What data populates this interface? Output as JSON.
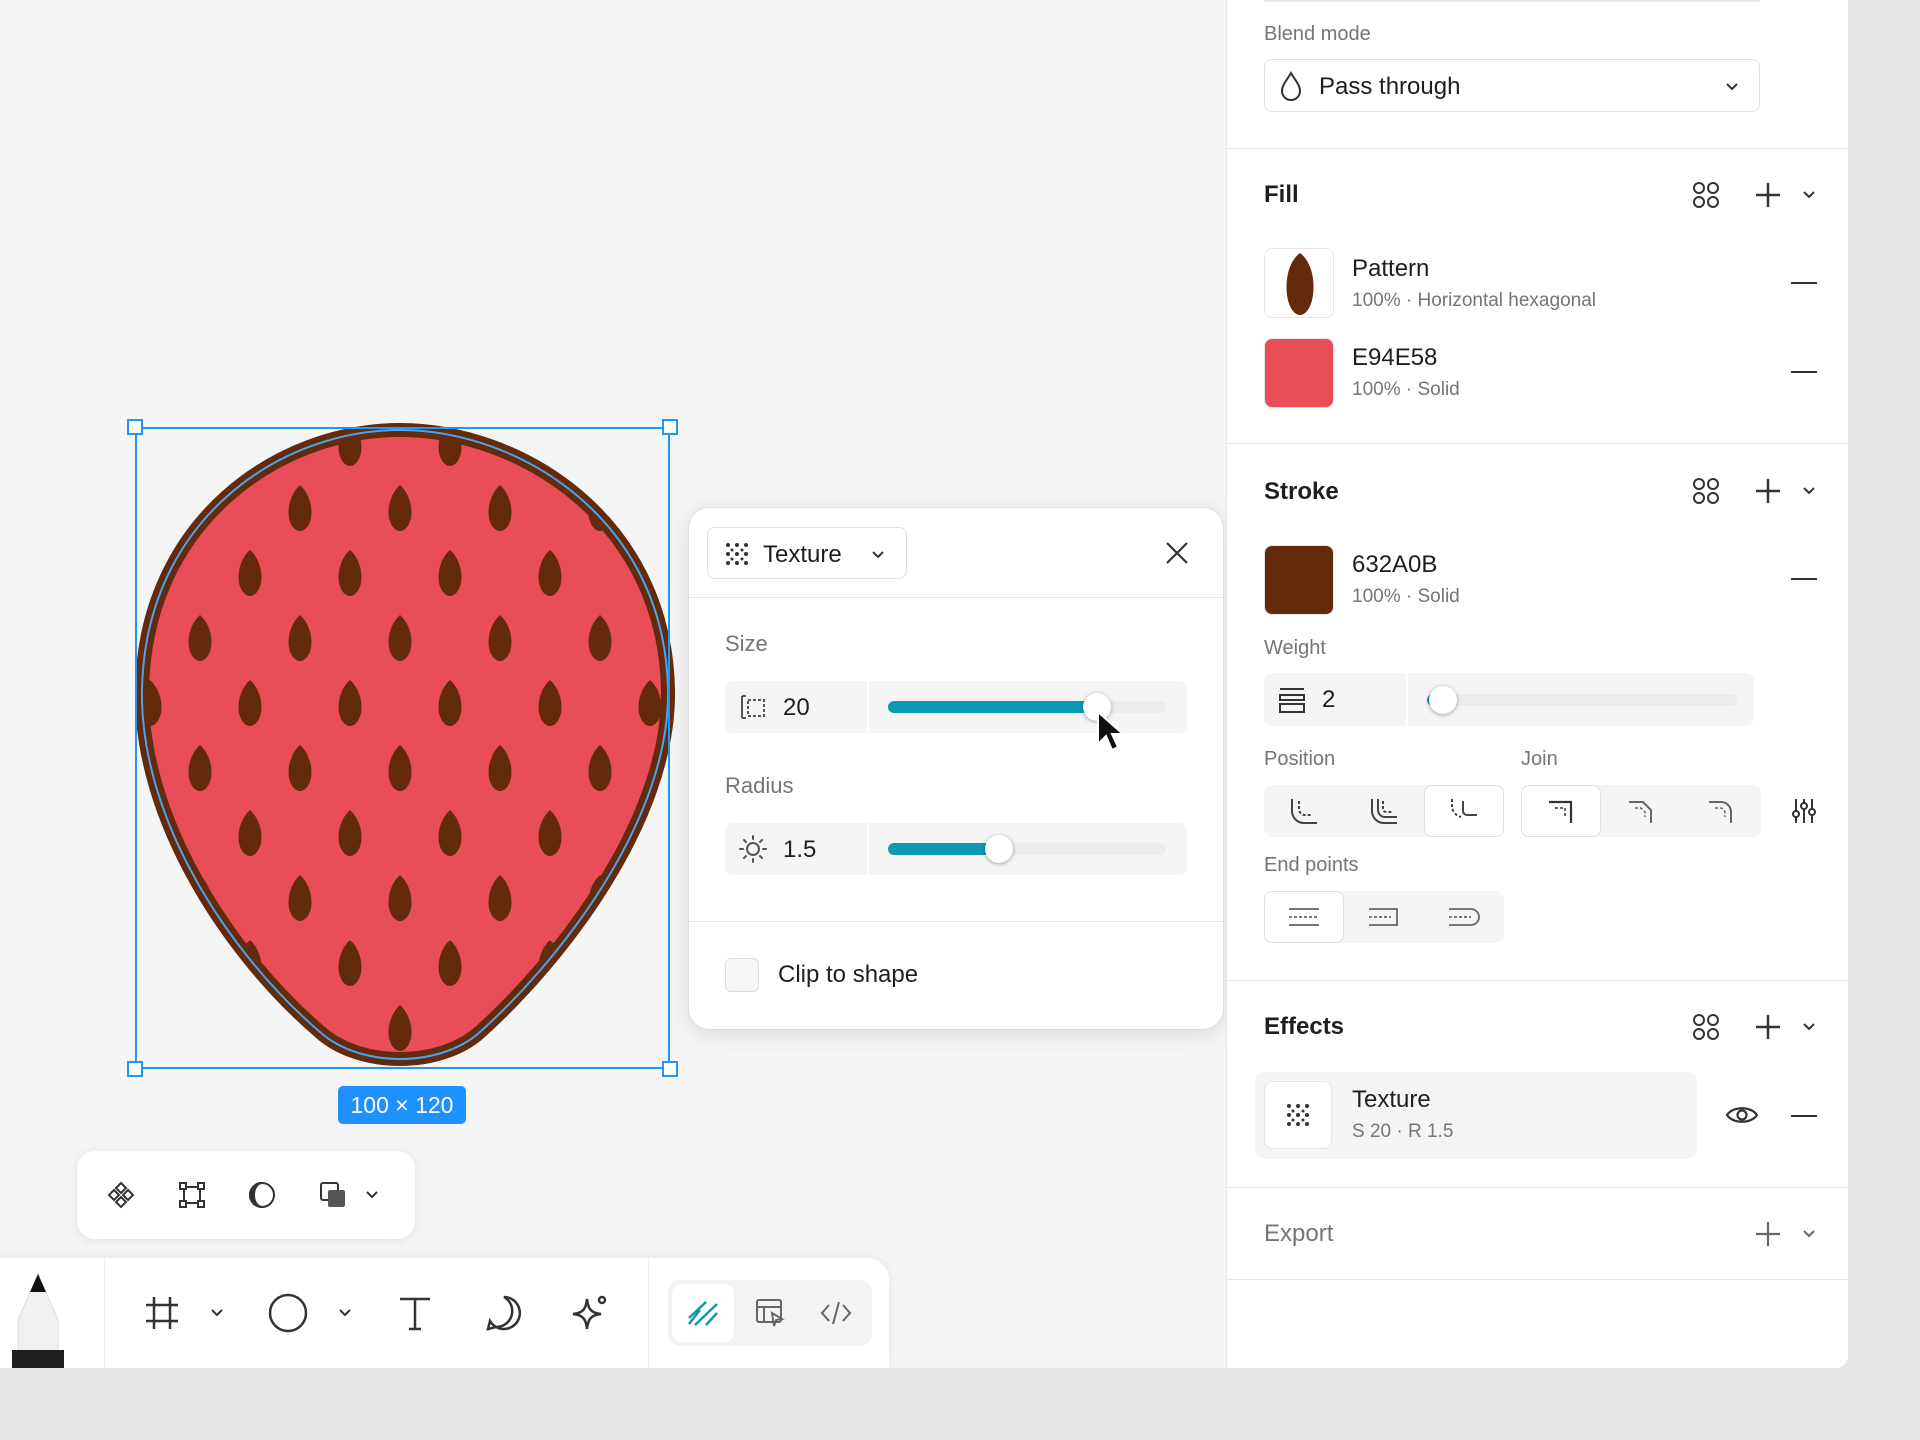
{
  "canvas": {
    "shape_size": "100 × 120",
    "colors": {
      "selection": "#1e90ff",
      "fill": "#E94E58",
      "stroke": "#632A0B"
    }
  },
  "panel": {
    "layer": {
      "blend_label": "Blend mode",
      "blend_value": "Pass through"
    },
    "fill": {
      "title": "Fill",
      "items": [
        {
          "name": "Pattern",
          "detail": "100% · Horizontal hexagonal"
        },
        {
          "name": "E94E58",
          "detail": "100% · Solid"
        }
      ]
    },
    "stroke": {
      "title": "Stroke",
      "item": {
        "name": "632A0B",
        "detail": "100% · Solid"
      },
      "weight_label": "Weight",
      "weight_value": "2",
      "weight_slider": 0.05,
      "position_label": "Position",
      "join_label": "Join",
      "endpoints_label": "End points"
    },
    "effects": {
      "title": "Effects",
      "item": {
        "name": "Texture",
        "detail": "S 20 · R 1.5"
      }
    },
    "export": {
      "title": "Export"
    }
  },
  "popup": {
    "type": "Texture",
    "size_label": "Size",
    "size_value": "20",
    "size_slider": 0.75,
    "radius_label": "Radius",
    "radius_value": "1.5",
    "radius_slider": 0.4,
    "clip_label": "Clip to shape",
    "clip_checked": false
  },
  "icons": [
    "drop-icon",
    "chevron-down-icon",
    "style-grid-icon",
    "plus-icon",
    "minus-icon",
    "eye-icon",
    "close-icon",
    "texture-icon",
    "frame-icon",
    "ellipse-icon",
    "text-icon",
    "comment-icon",
    "ai-sparkle-icon",
    "draw-icon",
    "dev-icon",
    "code-icon",
    "pencil-icon",
    "component-icon",
    "boolean-icon",
    "mask-icon",
    "layers-icon",
    "adjust-icon"
  ]
}
